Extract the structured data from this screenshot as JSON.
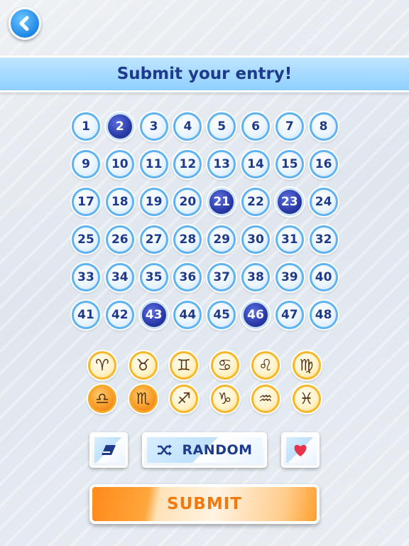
{
  "header": {
    "title": "Submit your entry!",
    "back_icon": "chevron-left-icon"
  },
  "numbers": [
    "1",
    "2",
    "3",
    "4",
    "5",
    "6",
    "7",
    "8",
    "9",
    "10",
    "11",
    "12",
    "13",
    "14",
    "15",
    "16",
    "17",
    "18",
    "19",
    "20",
    "21",
    "22",
    "23",
    "24",
    "25",
    "26",
    "27",
    "28",
    "29",
    "30",
    "31",
    "32",
    "33",
    "34",
    "35",
    "36",
    "37",
    "38",
    "39",
    "40",
    "41",
    "42",
    "43",
    "44",
    "45",
    "46",
    "47",
    "48"
  ],
  "selected_numbers": [
    2,
    21,
    23,
    43,
    46
  ],
  "zodiac": [
    {
      "sign": "aries-icon",
      "glyph": "♈",
      "selected": false
    },
    {
      "sign": "taurus-icon",
      "glyph": "♉",
      "selected": false
    },
    {
      "sign": "gemini-icon",
      "glyph": "♊",
      "selected": false
    },
    {
      "sign": "cancer-icon",
      "glyph": "♋",
      "selected": false
    },
    {
      "sign": "leo-icon",
      "glyph": "♌",
      "selected": false
    },
    {
      "sign": "virgo-icon",
      "glyph": "♍",
      "selected": false
    },
    {
      "sign": "libra-icon",
      "glyph": "♎",
      "selected": true
    },
    {
      "sign": "scorpio-icon",
      "glyph": "♏",
      "selected": true
    },
    {
      "sign": "sagittarius-icon",
      "glyph": "♐",
      "selected": false
    },
    {
      "sign": "capricorn-icon",
      "glyph": "♑",
      "selected": false
    },
    {
      "sign": "aquarius-icon",
      "glyph": "♒",
      "selected": false
    },
    {
      "sign": "pisces-icon",
      "glyph": "♓",
      "selected": false
    }
  ],
  "tools": {
    "eraser_icon": "eraser-icon",
    "random_label": "RANDOM",
    "shuffle_icon": "shuffle-icon",
    "favorite_icon": "heart-icon"
  },
  "submit": {
    "label": "SUBMIT"
  },
  "colors": {
    "accent": "#1e3a8a",
    "selected_ball": "#2a3aa8",
    "submit": "#ff8a1a",
    "heart": "#e8344a"
  }
}
